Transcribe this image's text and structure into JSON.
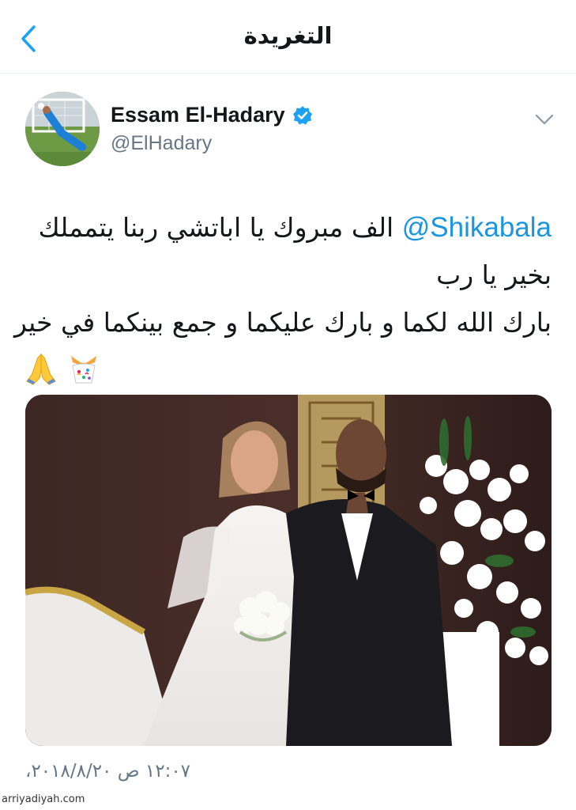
{
  "header": {
    "title": "التغريدة",
    "back_icon": "chevron-left-icon"
  },
  "author": {
    "name": "Essam El-Hadary",
    "handle": "@ElHadary",
    "verified": true,
    "avatar_icon": "avatar-goalkeeper-image"
  },
  "tweet": {
    "mention": "@Shikabala",
    "line1_text": "الف مبروك يا اباتشي ربنا يتمملك",
    "line2": "بخير يا رب",
    "line3": "بارك الله لكما و بارك عليكما و جمع بينكما في خير",
    "emojis": [
      "confetti-gift-emoji",
      "praying-hands-emoji"
    ]
  },
  "photo": {
    "description_icon": "wedding-photo"
  },
  "meta": {
    "timestamp": "١٢:٠٧ ص ٢٠١٨/٨/٢٠،"
  },
  "watermark": "arriyadiyah.com",
  "colors": {
    "link": "#1b95e0",
    "verified": "#1da1f2",
    "secondary_text": "#657786",
    "divider": "#e6ecf0"
  }
}
